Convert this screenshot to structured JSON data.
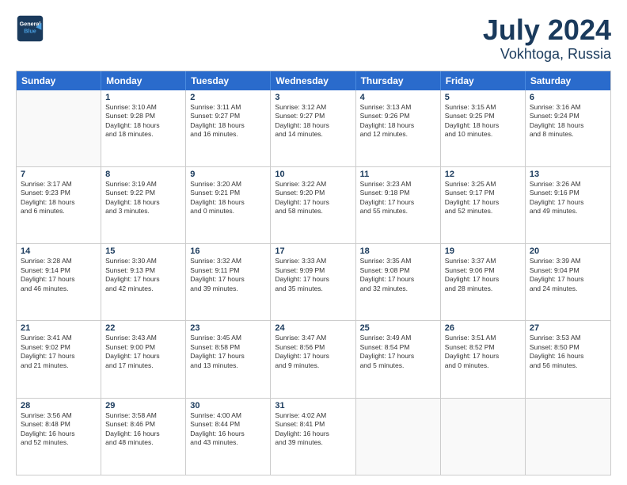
{
  "header": {
    "logo_line1": "General",
    "logo_line2": "Blue",
    "title": "July 2024",
    "subtitle": "Vokhtoga, Russia"
  },
  "weekdays": [
    "Sunday",
    "Monday",
    "Tuesday",
    "Wednesday",
    "Thursday",
    "Friday",
    "Saturday"
  ],
  "weeks": [
    [
      {
        "day": "",
        "info": ""
      },
      {
        "day": "1",
        "info": "Sunrise: 3:10 AM\nSunset: 9:28 PM\nDaylight: 18 hours\nand 18 minutes."
      },
      {
        "day": "2",
        "info": "Sunrise: 3:11 AM\nSunset: 9:27 PM\nDaylight: 18 hours\nand 16 minutes."
      },
      {
        "day": "3",
        "info": "Sunrise: 3:12 AM\nSunset: 9:27 PM\nDaylight: 18 hours\nand 14 minutes."
      },
      {
        "day": "4",
        "info": "Sunrise: 3:13 AM\nSunset: 9:26 PM\nDaylight: 18 hours\nand 12 minutes."
      },
      {
        "day": "5",
        "info": "Sunrise: 3:15 AM\nSunset: 9:25 PM\nDaylight: 18 hours\nand 10 minutes."
      },
      {
        "day": "6",
        "info": "Sunrise: 3:16 AM\nSunset: 9:24 PM\nDaylight: 18 hours\nand 8 minutes."
      }
    ],
    [
      {
        "day": "7",
        "info": "Sunrise: 3:17 AM\nSunset: 9:23 PM\nDaylight: 18 hours\nand 6 minutes."
      },
      {
        "day": "8",
        "info": "Sunrise: 3:19 AM\nSunset: 9:22 PM\nDaylight: 18 hours\nand 3 minutes."
      },
      {
        "day": "9",
        "info": "Sunrise: 3:20 AM\nSunset: 9:21 PM\nDaylight: 18 hours\nand 0 minutes."
      },
      {
        "day": "10",
        "info": "Sunrise: 3:22 AM\nSunset: 9:20 PM\nDaylight: 17 hours\nand 58 minutes."
      },
      {
        "day": "11",
        "info": "Sunrise: 3:23 AM\nSunset: 9:18 PM\nDaylight: 17 hours\nand 55 minutes."
      },
      {
        "day": "12",
        "info": "Sunrise: 3:25 AM\nSunset: 9:17 PM\nDaylight: 17 hours\nand 52 minutes."
      },
      {
        "day": "13",
        "info": "Sunrise: 3:26 AM\nSunset: 9:16 PM\nDaylight: 17 hours\nand 49 minutes."
      }
    ],
    [
      {
        "day": "14",
        "info": "Sunrise: 3:28 AM\nSunset: 9:14 PM\nDaylight: 17 hours\nand 46 minutes."
      },
      {
        "day": "15",
        "info": "Sunrise: 3:30 AM\nSunset: 9:13 PM\nDaylight: 17 hours\nand 42 minutes."
      },
      {
        "day": "16",
        "info": "Sunrise: 3:32 AM\nSunset: 9:11 PM\nDaylight: 17 hours\nand 39 minutes."
      },
      {
        "day": "17",
        "info": "Sunrise: 3:33 AM\nSunset: 9:09 PM\nDaylight: 17 hours\nand 35 minutes."
      },
      {
        "day": "18",
        "info": "Sunrise: 3:35 AM\nSunset: 9:08 PM\nDaylight: 17 hours\nand 32 minutes."
      },
      {
        "day": "19",
        "info": "Sunrise: 3:37 AM\nSunset: 9:06 PM\nDaylight: 17 hours\nand 28 minutes."
      },
      {
        "day": "20",
        "info": "Sunrise: 3:39 AM\nSunset: 9:04 PM\nDaylight: 17 hours\nand 24 minutes."
      }
    ],
    [
      {
        "day": "21",
        "info": "Sunrise: 3:41 AM\nSunset: 9:02 PM\nDaylight: 17 hours\nand 21 minutes."
      },
      {
        "day": "22",
        "info": "Sunrise: 3:43 AM\nSunset: 9:00 PM\nDaylight: 17 hours\nand 17 minutes."
      },
      {
        "day": "23",
        "info": "Sunrise: 3:45 AM\nSunset: 8:58 PM\nDaylight: 17 hours\nand 13 minutes."
      },
      {
        "day": "24",
        "info": "Sunrise: 3:47 AM\nSunset: 8:56 PM\nDaylight: 17 hours\nand 9 minutes."
      },
      {
        "day": "25",
        "info": "Sunrise: 3:49 AM\nSunset: 8:54 PM\nDaylight: 17 hours\nand 5 minutes."
      },
      {
        "day": "26",
        "info": "Sunrise: 3:51 AM\nSunset: 8:52 PM\nDaylight: 17 hours\nand 0 minutes."
      },
      {
        "day": "27",
        "info": "Sunrise: 3:53 AM\nSunset: 8:50 PM\nDaylight: 16 hours\nand 56 minutes."
      }
    ],
    [
      {
        "day": "28",
        "info": "Sunrise: 3:56 AM\nSunset: 8:48 PM\nDaylight: 16 hours\nand 52 minutes."
      },
      {
        "day": "29",
        "info": "Sunrise: 3:58 AM\nSunset: 8:46 PM\nDaylight: 16 hours\nand 48 minutes."
      },
      {
        "day": "30",
        "info": "Sunrise: 4:00 AM\nSunset: 8:44 PM\nDaylight: 16 hours\nand 43 minutes."
      },
      {
        "day": "31",
        "info": "Sunrise: 4:02 AM\nSunset: 8:41 PM\nDaylight: 16 hours\nand 39 minutes."
      },
      {
        "day": "",
        "info": ""
      },
      {
        "day": "",
        "info": ""
      },
      {
        "day": "",
        "info": ""
      }
    ]
  ]
}
